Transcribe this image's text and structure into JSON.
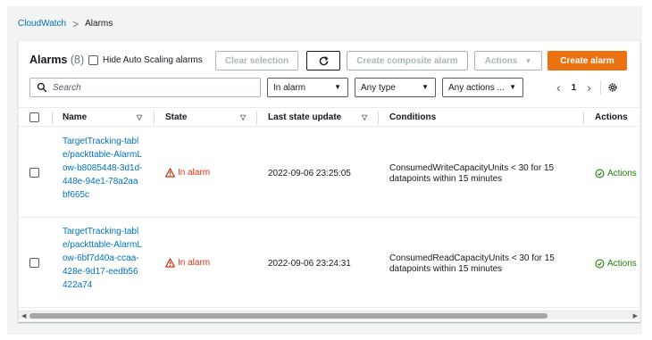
{
  "breadcrumb": {
    "root": "CloudWatch",
    "separator": ">",
    "current": "Alarms"
  },
  "header": {
    "title": "Alarms",
    "count": "(8)",
    "hide_autoscaling_label": "Hide Auto Scaling alarms",
    "clear_selection": "Clear selection",
    "refresh_icon": "refresh-icon",
    "create_composite": "Create composite alarm",
    "actions": "Actions",
    "create_alarm": "Create alarm"
  },
  "filters": {
    "search_placeholder": "Search",
    "state_filter": "In alarm",
    "type_filter": "Any type",
    "actions_filter": "Any actions ...",
    "page": "1"
  },
  "columns": [
    "Name",
    "State",
    "Last state update",
    "Conditions",
    "Actions"
  ],
  "rows": [
    {
      "name": "TargetTracking-table/packttable-AlarmLow-b8085448-3d1d-448e-94e1-78a2aabf665c",
      "state": "In alarm",
      "last_update": "2022-09-06 23:25:05",
      "conditions": "ConsumedWriteCapacityUnits < 30 for 15 datapoints within 15 minutes",
      "actions": "Actions"
    },
    {
      "name": "TargetTracking-table/packttable-AlarmLow-6bf7d40a-ccaa-428e-9d17-eedb56422a74",
      "state": "In alarm",
      "last_update": "2022-09-06 23:24:31",
      "conditions": "ConsumedReadCapacityUnits < 30 for 15 datapoints within 15 minutes",
      "actions": "Actions"
    }
  ],
  "colors": {
    "accent": "#ec7211",
    "link": "#0073bb",
    "alarm": "#d13212",
    "ok": "#1d8102"
  }
}
